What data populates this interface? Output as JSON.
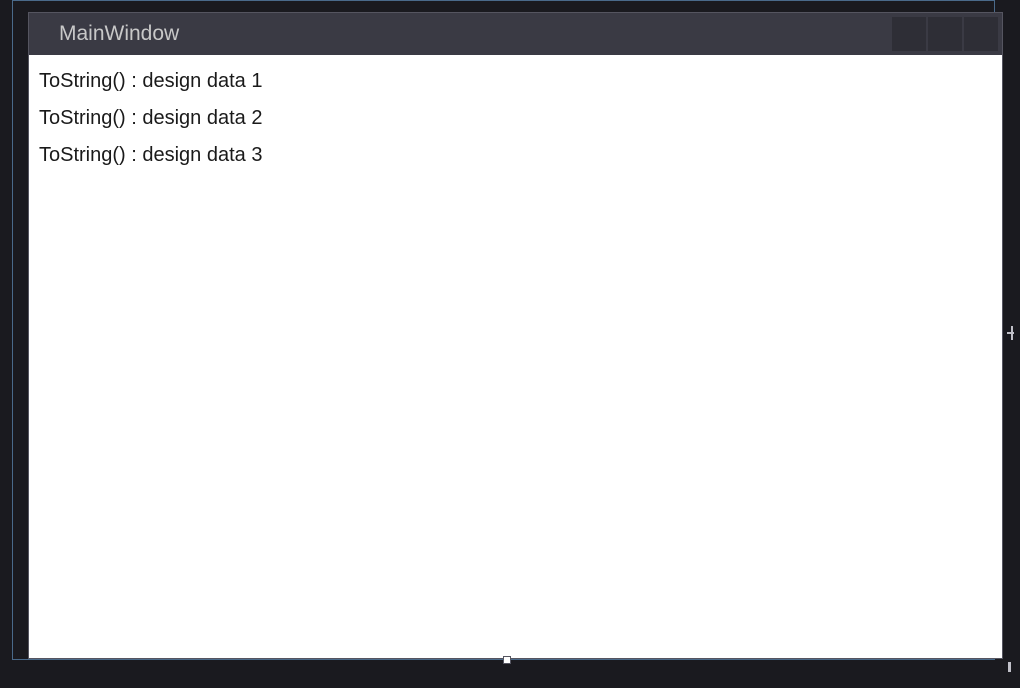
{
  "window": {
    "title": "MainWindow"
  },
  "list": {
    "items": [
      {
        "text": "ToString() : design data 1"
      },
      {
        "text": "ToString() : design data 2"
      },
      {
        "text": "ToString() : design data 3"
      }
    ]
  }
}
